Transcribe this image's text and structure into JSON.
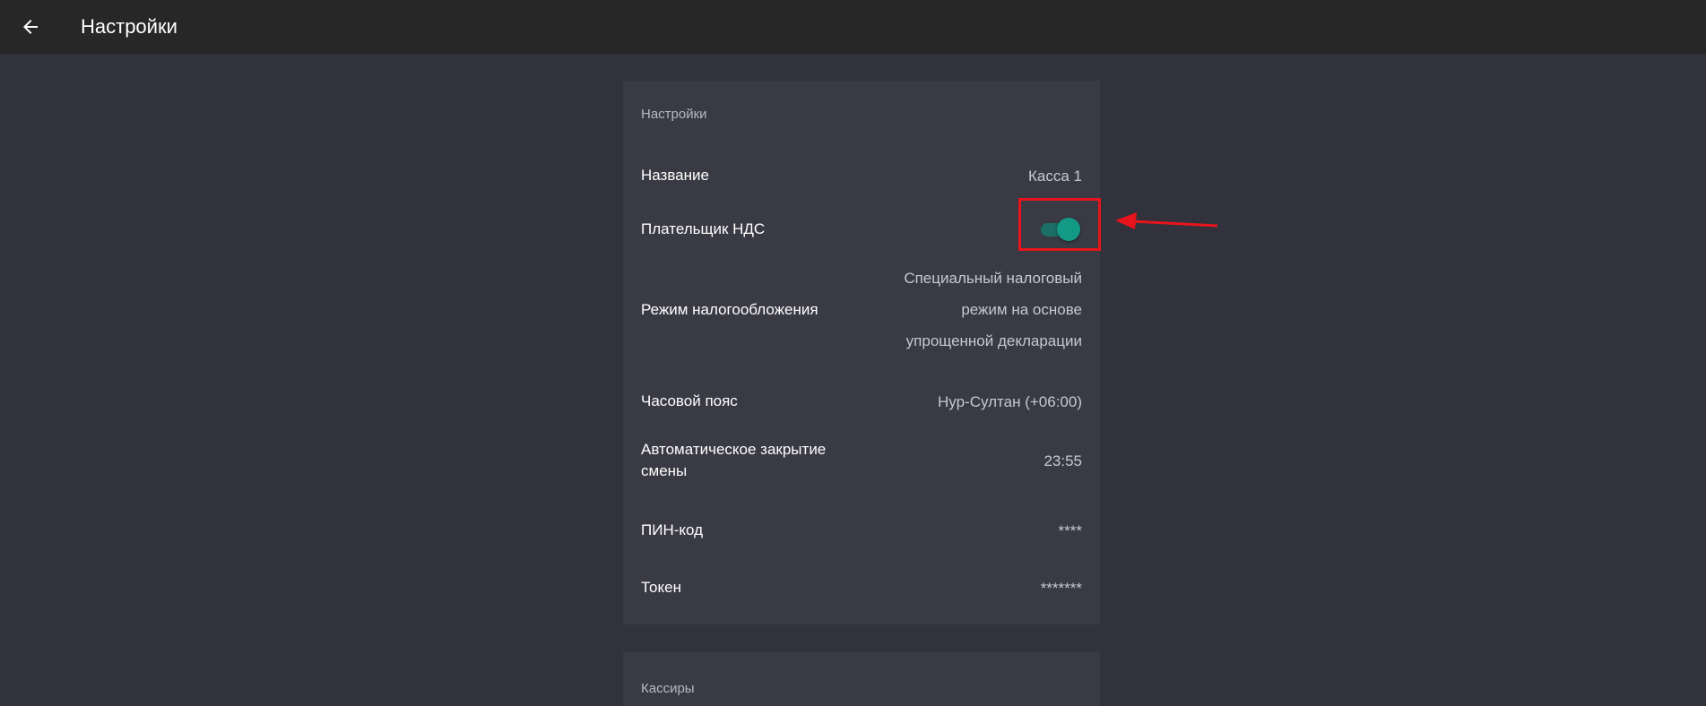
{
  "app": {
    "title": "Настройки",
    "back_icon": "arrow-left-icon"
  },
  "settings": {
    "header": "Настройки",
    "rows": [
      {
        "label": "Название",
        "value": "Касса 1"
      },
      {
        "label": "Плательщик НДС",
        "toggle": true
      },
      {
        "label": "Режим налогообложения",
        "value_lines": [
          "Специальный налоговый",
          "режим на основе",
          "упрощенной декларации"
        ]
      },
      {
        "label": "Часовой пояс",
        "value": "Нур-Султан (+06:00)"
      },
      {
        "label_lines": [
          "Автоматическое закрытие",
          "смены"
        ],
        "value": "23:55"
      },
      {
        "label": "ПИН-код",
        "value": "****"
      },
      {
        "label": "Токен",
        "value": "*******"
      }
    ]
  },
  "cashiers": {
    "header": "Кассиры"
  },
  "colors": {
    "toggle_on": "#139a87",
    "annotation": "#e8141b"
  }
}
